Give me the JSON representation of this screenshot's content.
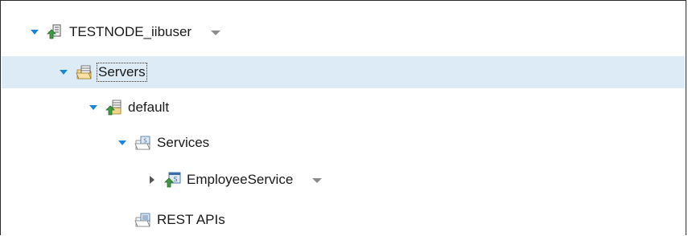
{
  "tree": {
    "node": {
      "label": "TESTNODE_iibuser",
      "icon": "integration-node-icon",
      "expanded": true,
      "has_menu": true
    },
    "servers": {
      "label": "Servers",
      "icon": "servers-folder-icon",
      "expanded": true,
      "selected": true
    },
    "default_server": {
      "label": "default",
      "icon": "integration-server-icon",
      "expanded": true
    },
    "services": {
      "label": "Services",
      "icon": "services-folder-icon",
      "expanded": true
    },
    "employee_service": {
      "label": "EmployeeService",
      "icon": "service-icon",
      "expanded": false,
      "has_menu": true
    },
    "rest_apis": {
      "label": "REST APIs",
      "icon": "rest-apis-folder-icon"
    }
  },
  "colors": {
    "twisty": "#1b85d6",
    "selection": "#dcebf6",
    "menu_arrow": "#8c8c8c",
    "folder": "#e3b341",
    "node_green": "#3f9b3f"
  }
}
